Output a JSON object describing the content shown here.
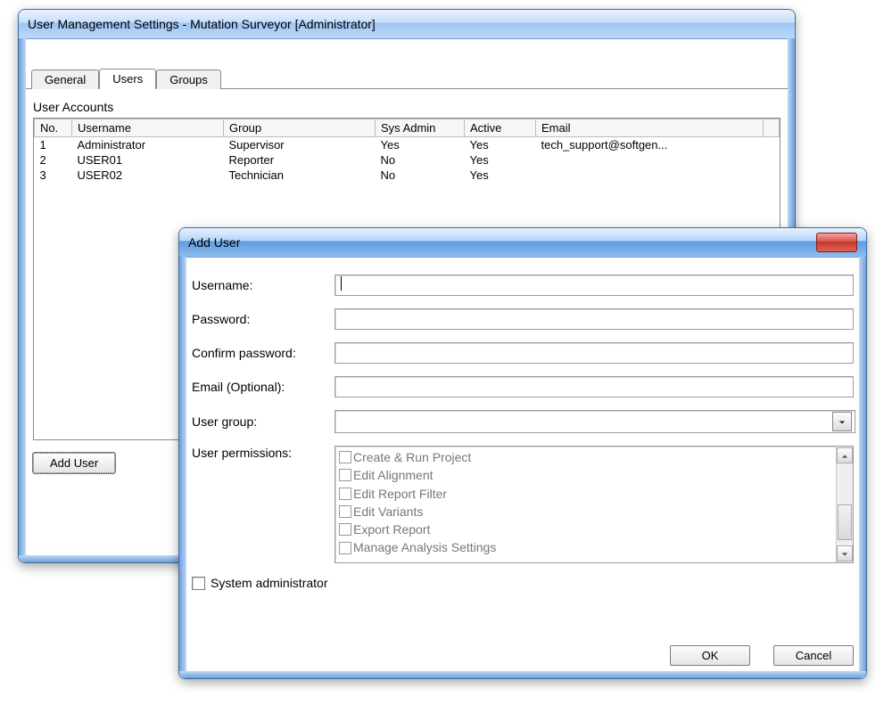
{
  "main_window": {
    "title": "User Management Settings - Mutation Surveyor [Administrator]",
    "tabs": {
      "general": "General",
      "users": "Users",
      "groups": "Groups"
    },
    "section_label": "User Accounts",
    "columns": {
      "no": "No.",
      "username": "Username",
      "group": "Group",
      "sysadmin": "Sys Admin",
      "active": "Active",
      "email": "Email"
    },
    "rows": [
      {
        "no": "1",
        "username": "Administrator",
        "group": "Supervisor",
        "sysadmin": "Yes",
        "active": "Yes",
        "email": "tech_support@softgen..."
      },
      {
        "no": "2",
        "username": "USER01",
        "group": "Reporter",
        "sysadmin": "No",
        "active": "Yes",
        "email": ""
      },
      {
        "no": "3",
        "username": "USER02",
        "group": "Technician",
        "sysadmin": "No",
        "active": "Yes",
        "email": ""
      }
    ],
    "add_user_button": "Add User"
  },
  "dialog": {
    "title": "Add User",
    "labels": {
      "username": "Username:",
      "password": "Password:",
      "confirm": "Confirm password:",
      "email": "Email (Optional):",
      "group": "User group:",
      "permissions": "User permissions:",
      "sysadmin": "System administrator"
    },
    "permissions": [
      "Create & Run Project",
      "Edit Alignment",
      "Edit Report Filter",
      "Edit Variants",
      "Export Report",
      "Manage Analysis Settings"
    ],
    "buttons": {
      "ok": "OK",
      "cancel": "Cancel"
    }
  }
}
